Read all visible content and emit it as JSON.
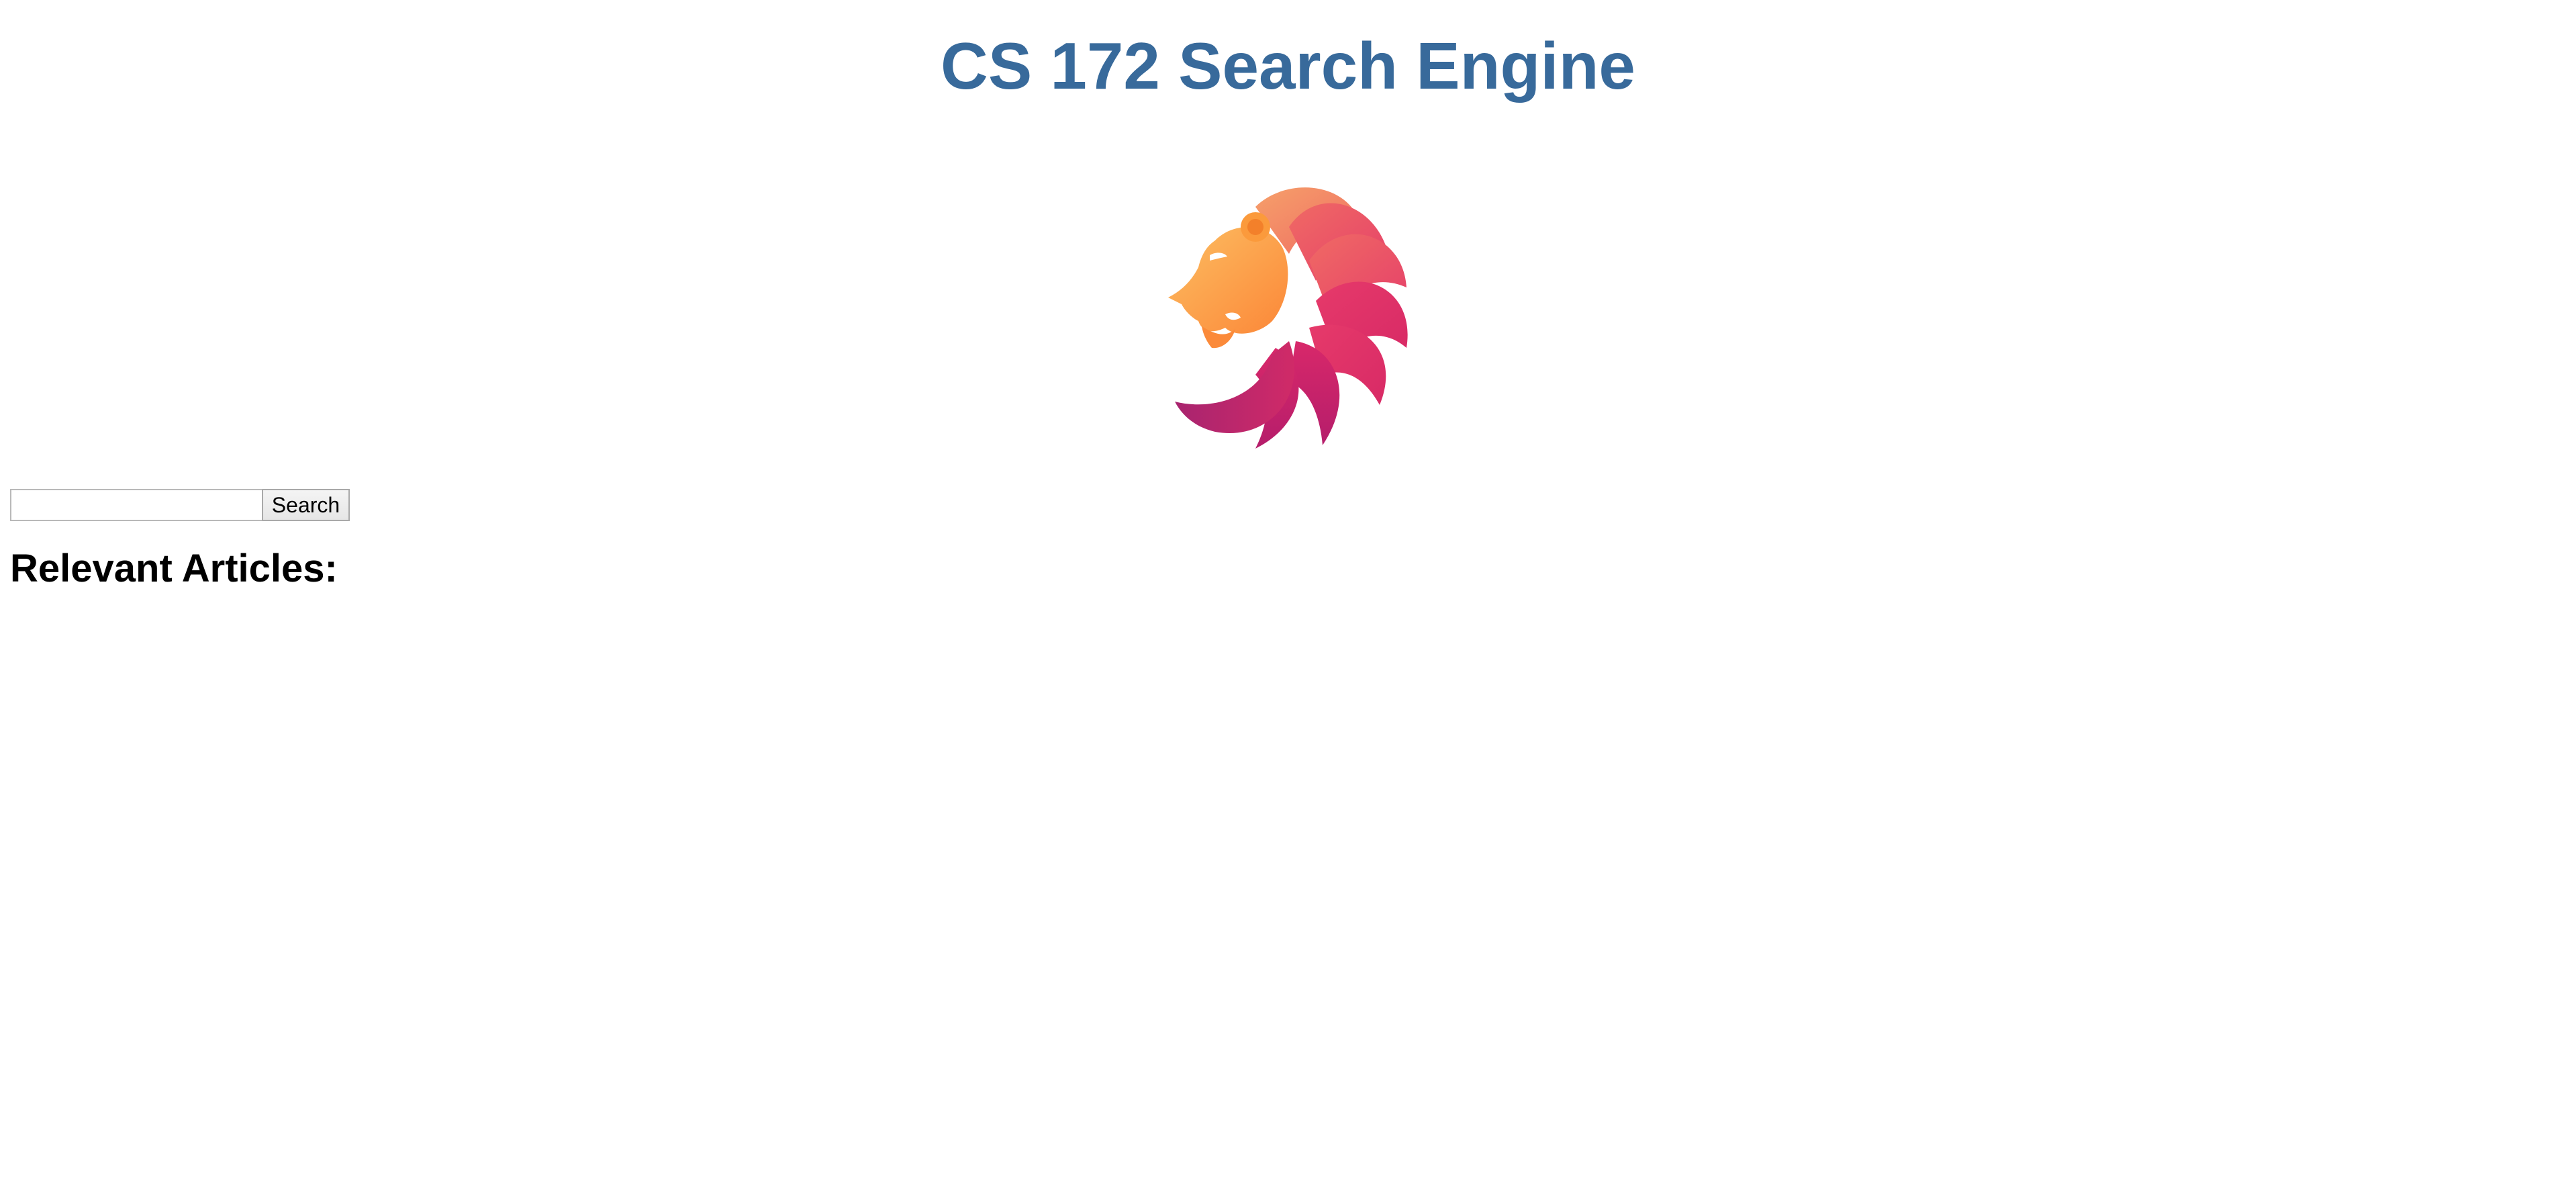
{
  "header": {
    "title": "CS 172 Search Engine"
  },
  "logo": {
    "icon": "lion-logo-icon",
    "colors": {
      "orange": "#fb8a3a",
      "light_orange": "#fdb35e",
      "coral": "#f0675f",
      "pink": "#e33066",
      "magenta": "#b81e6c"
    }
  },
  "search": {
    "input_value": "",
    "button_label": "Search"
  },
  "results": {
    "heading": "Relevant Articles:",
    "items": []
  },
  "colors": {
    "title": "#386a9b",
    "background": "#ffffff"
  }
}
